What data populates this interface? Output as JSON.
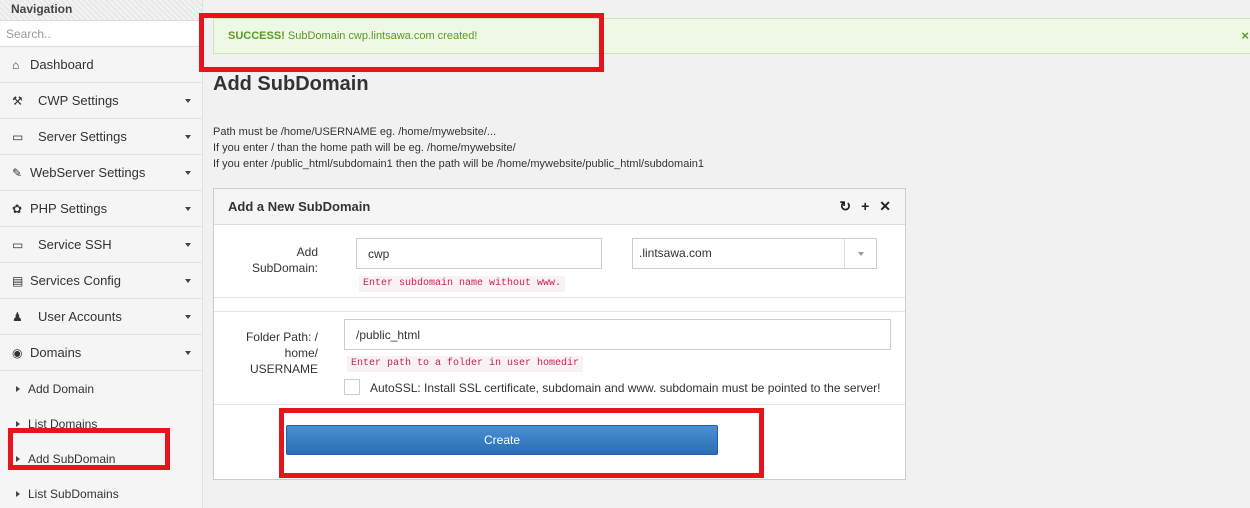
{
  "sidebar": {
    "title": "Navigation",
    "search_placeholder": "Search..",
    "items": [
      {
        "label": "Dashboard",
        "icon": "home-icon"
      },
      {
        "label": "CWP Settings",
        "icon": "tools-icon"
      },
      {
        "label": "Server Settings",
        "icon": "server-icon"
      },
      {
        "label": "WebServer Settings",
        "icon": "feather-icon"
      },
      {
        "label": "PHP Settings",
        "icon": "gear-icon"
      },
      {
        "label": "Service SSH",
        "icon": "monitor-icon"
      },
      {
        "label": "Services Config",
        "icon": "config-icon"
      },
      {
        "label": "User Accounts",
        "icon": "user-icon"
      },
      {
        "label": "Domains",
        "icon": "globe-icon"
      }
    ],
    "sub_items": [
      {
        "label": "Add Domain"
      },
      {
        "label": "List Domains"
      },
      {
        "label": "Add SubDomain"
      },
      {
        "label": "List SubDomains"
      }
    ]
  },
  "alert": {
    "status": "SUCCESS!",
    "message": " SubDomain cwp.lintsawa.com created!",
    "close": "×",
    "color": "#5a9a28"
  },
  "page": {
    "title": "Add SubDomain",
    "instructions": [
      "Path must be /home/USERNAME eg. /home/mywebsite/...",
      "If you enter / than the home path will be eg. /home/mywebsite/",
      "If you enter /public_html/subdomain1 then the path will be /home/mywebsite/public_html/subdomain1"
    ]
  },
  "panel": {
    "title": "Add a New SubDomain",
    "tools": [
      "↻",
      "+",
      "✕"
    ],
    "subdomain_label_1": "Add",
    "subdomain_label_2": "SubDomain:",
    "subdomain_value": "cwp",
    "subdomain_hint": "Enter subdomain name without www.",
    "domain_select": ".lintsawa.com",
    "folder_label_1": "Folder Path: /",
    "folder_label_2": "home/",
    "folder_label_3": "USERNAME",
    "folder_value": "/public_html",
    "folder_hint": "Enter path to a folder in user homedir",
    "autossl_label": "AutoSSL: Install SSL certificate, subdomain and www. subdomain must be pointed to the server!",
    "create_label": "Create",
    "accent_color": "#2a6db4",
    "highlight_color": "#e8141c"
  }
}
